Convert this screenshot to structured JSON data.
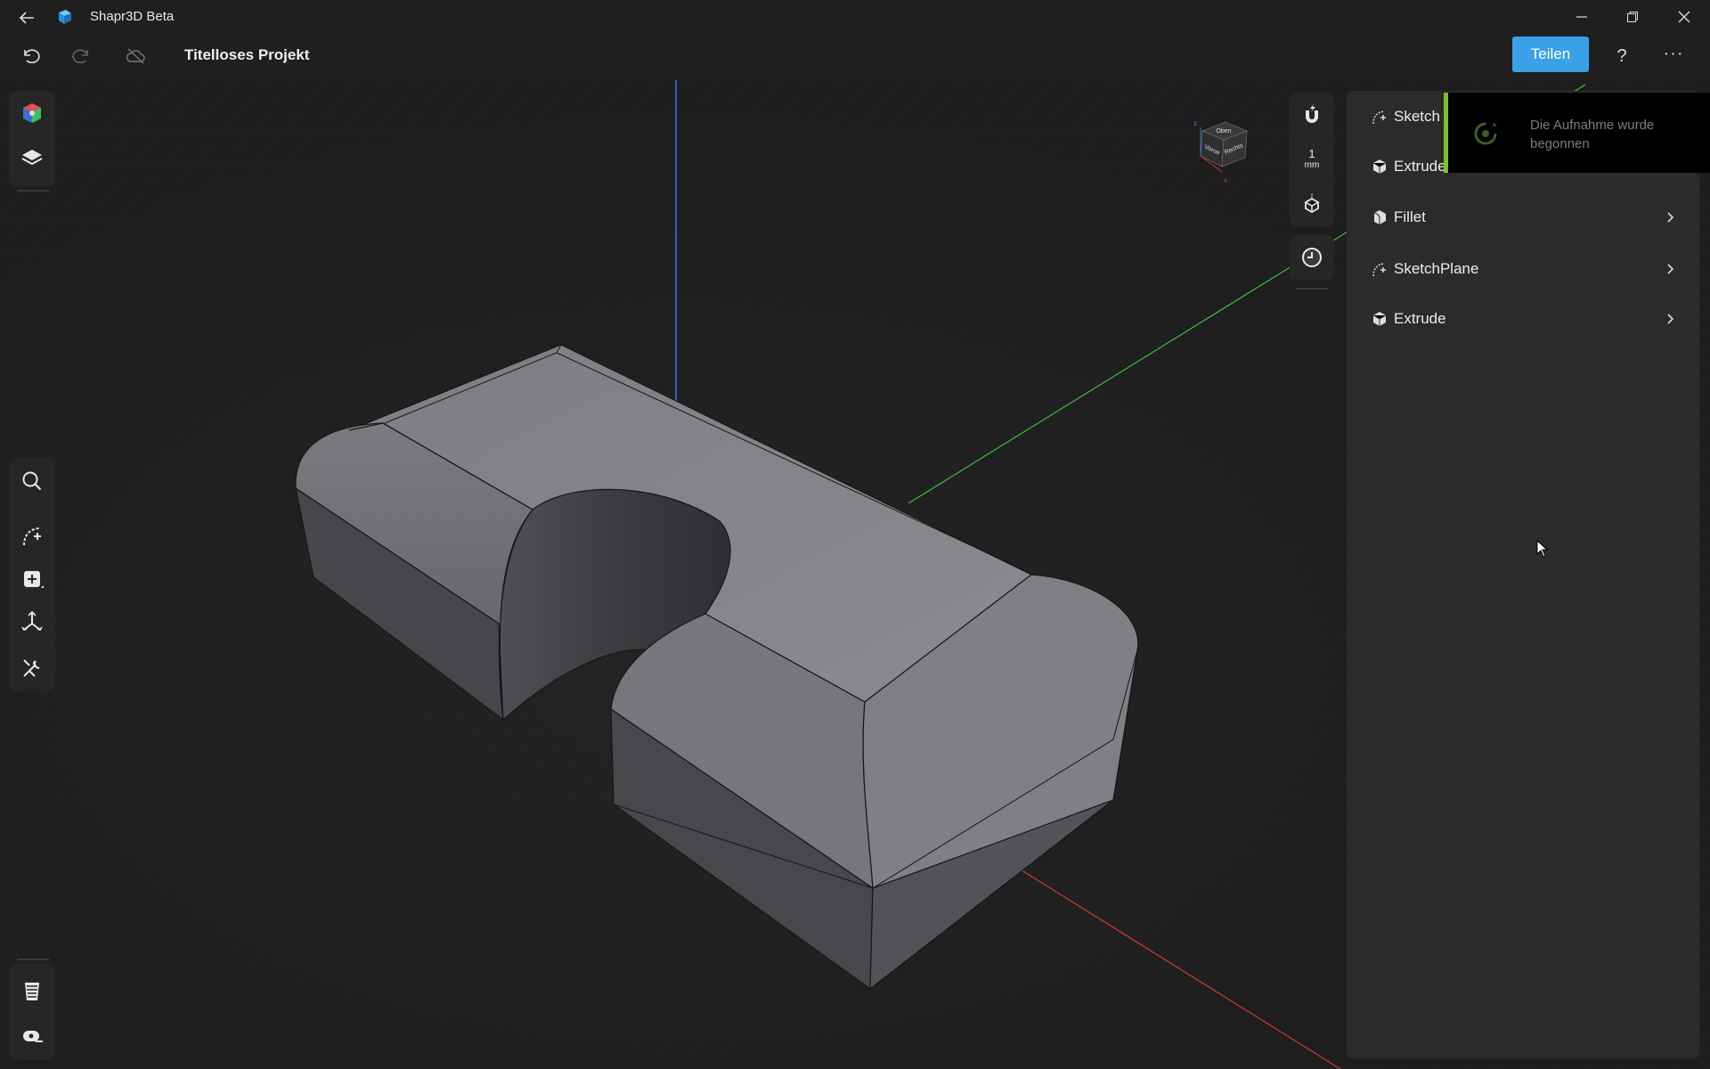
{
  "window": {
    "app_name": "Shapr3D Beta",
    "accent": "#3aa0e8"
  },
  "toolbar": {
    "project_title": "Titelloses Projekt",
    "share_label": "Teilen",
    "help_label": "?",
    "more_label": "···"
  },
  "view_tools": {
    "scale_value": "1",
    "scale_unit": "mm"
  },
  "nav_cube": {
    "faces": [
      "Oben",
      "Vorne",
      "Rechts"
    ],
    "axes": [
      "z",
      "x"
    ]
  },
  "history": {
    "items": [
      {
        "label": "Sketch",
        "icon": "sketch-icon"
      },
      {
        "label": "Extrude",
        "icon": "extrude-icon"
      },
      {
        "label": "Fillet",
        "icon": "fillet-icon"
      },
      {
        "label": "SketchPlane",
        "icon": "sketch-icon"
      },
      {
        "label": "Extrude",
        "icon": "extrude-icon"
      }
    ]
  },
  "toast": {
    "message": "Die Aufnahme wurde begonnen",
    "accent": "#7cc228"
  },
  "left_tools": [
    "appearance-icon",
    "layers-icon",
    "search-icon",
    "sketch-tool-icon",
    "add-body-icon",
    "transform-icon",
    "tools-icon",
    "section-icon",
    "measure-icon"
  ],
  "axis_colors": {
    "x": "#d63a2f",
    "y": "#3fbf3f",
    "z": "#2f7de0"
  }
}
